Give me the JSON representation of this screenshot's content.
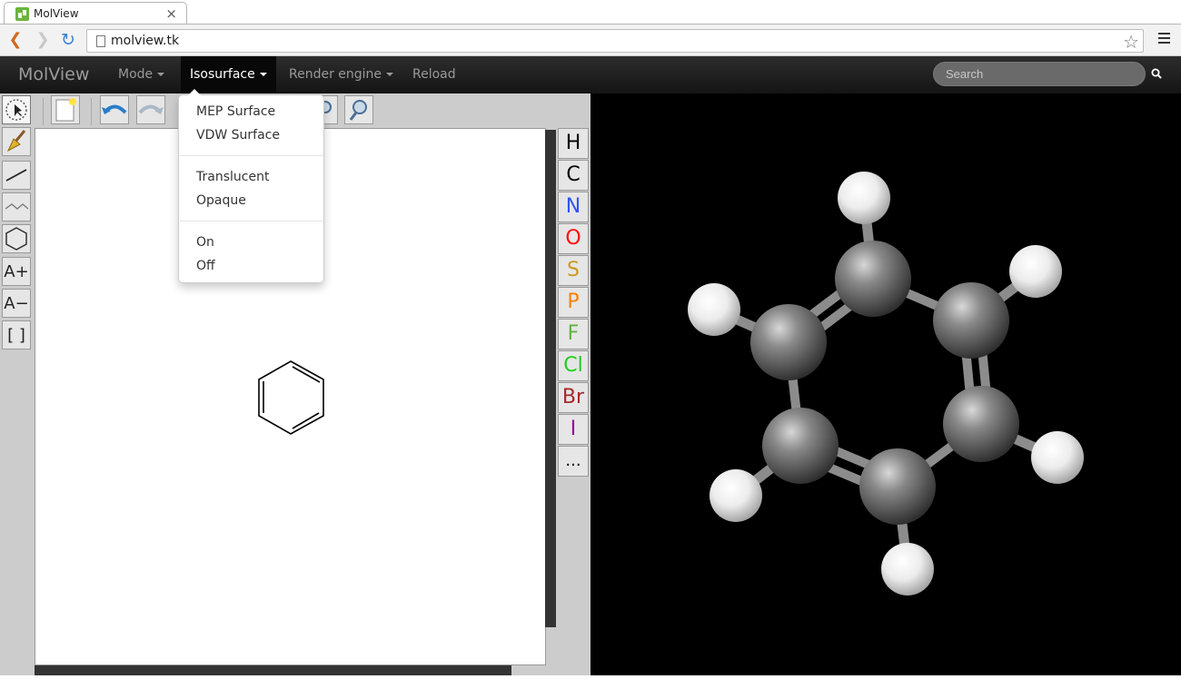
{
  "browser": {
    "tab_title": "MolView",
    "tab_close": "×",
    "url": "molview.tk"
  },
  "navbar": {
    "brand": "MolView",
    "menus": [
      {
        "label": "Mode"
      },
      {
        "label": "Isosurface"
      },
      {
        "label": "Render engine"
      },
      {
        "label": "Reload"
      }
    ],
    "search_placeholder": "Search"
  },
  "dropdown": {
    "items": [
      "MEP Surface",
      "VDW Surface",
      "Translucent",
      "Opaque",
      "On",
      "Off"
    ]
  },
  "editor_tools": {
    "charge_plus": "A+",
    "charge_minus": "A−",
    "brackets": "[ ]"
  },
  "elements": [
    {
      "symbol": "H",
      "color": "#000000"
    },
    {
      "symbol": "C",
      "color": "#000000"
    },
    {
      "symbol": "N",
      "color": "#3050f8"
    },
    {
      "symbol": "O",
      "color": "#ff0d0d"
    },
    {
      "symbol": "S",
      "color": "#c99a1f"
    },
    {
      "symbol": "P",
      "color": "#ff8000"
    },
    {
      "symbol": "F",
      "color": "#5fb53c"
    },
    {
      "symbol": "Cl",
      "color": "#1fcf1f"
    },
    {
      "symbol": "Br",
      "color": "#a62929"
    },
    {
      "symbol": "I",
      "color": "#940094"
    },
    {
      "symbol": "...",
      "color": "#000000"
    }
  ],
  "colors": {
    "navbar_bg": "#1b1b1b",
    "viewer_bg": "#000000",
    "editor_bg": "#cccccc"
  }
}
